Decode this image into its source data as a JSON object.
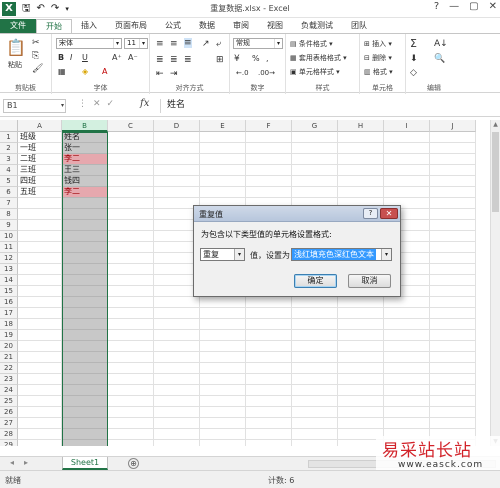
{
  "window": {
    "title": "重复数据.xlsx - Excel",
    "min": "—",
    "restore": "▢",
    "close": "✕"
  },
  "tabs": [
    {
      "label": "文件"
    },
    {
      "label": "开始"
    },
    {
      "label": "插入"
    },
    {
      "label": "页面布局"
    },
    {
      "label": "公式"
    },
    {
      "label": "数据"
    },
    {
      "label": "审阅"
    },
    {
      "label": "视图"
    },
    {
      "label": "负载测试"
    },
    {
      "label": "团队"
    }
  ],
  "ribbon": {
    "clipboard": {
      "paste": "粘贴",
      "label": "剪贴板"
    },
    "font": {
      "name": "宋体",
      "size": "11",
      "label": "字体"
    },
    "alignment": {
      "label": "对齐方式"
    },
    "number": {
      "format": "常规",
      "percent": "%",
      "comma": ",",
      "label": "数字"
    },
    "styles": {
      "conditional": "条件格式",
      "table": "套用表格格式",
      "cell": "单元格样式",
      "label": "样式"
    },
    "cells": {
      "insert": "插入",
      "delete": "删除",
      "format": "格式",
      "label": "单元格"
    },
    "editing": {
      "sum": "Σ",
      "label": "编辑"
    }
  },
  "formula_bar": {
    "name_box": "B1",
    "fx": "fx",
    "content": "姓名"
  },
  "sheet": {
    "columns": [
      "A",
      "B",
      "C",
      "D",
      "E",
      "F",
      "G",
      "H",
      "I",
      "J"
    ],
    "rows": [
      "1",
      "2",
      "3",
      "4",
      "5",
      "6",
      "7",
      "8",
      "9",
      "10",
      "11",
      "12",
      "13",
      "14",
      "15",
      "16",
      "17",
      "18",
      "19",
      "20",
      "21",
      "22",
      "23",
      "24",
      "25",
      "26",
      "27",
      "28",
      "29"
    ],
    "data": [
      {
        "a": "班级",
        "b": "姓名",
        "dup": false
      },
      {
        "a": "一班",
        "b": "张一",
        "dup": false
      },
      {
        "a": "二班",
        "b": "李二",
        "dup": true
      },
      {
        "a": "三班",
        "b": "王三",
        "dup": false
      },
      {
        "a": "四班",
        "b": "钱四",
        "dup": false
      },
      {
        "a": "五班",
        "b": "李二",
        "dup": true
      }
    ],
    "duplicate_fill": "#e6a8ae",
    "duplicate_text": "#9c0006"
  },
  "sheet_tab": "Sheet1",
  "add_sheet": "⊕",
  "status": {
    "ready": "就绪",
    "count": "计数: 6"
  },
  "dialog": {
    "title": "重复值",
    "help": "?",
    "close": "✕",
    "prompt": "为包含以下类型值的单元格设置格式:",
    "type_value": "重复",
    "middle_text": "值，设置为",
    "format_value": "浅红填充色深红色文本",
    "ok": "确定",
    "cancel": "取消"
  },
  "watermark": {
    "big": "易采站长站",
    "small": "www.easck.com"
  }
}
